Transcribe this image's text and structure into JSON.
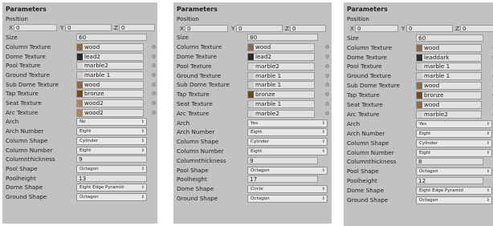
{
  "labels": {
    "title": "Parameters",
    "position": "Position",
    "x": "X",
    "y": "Y",
    "z": "Z",
    "size": "Size",
    "column_texture": "Column Texture",
    "dome_texture": "Dome Texture",
    "pool_texture": "Pool Texture",
    "ground_texture": "Ground Texture",
    "sub_dome_texture": "Sub Dome Texture",
    "tap_texture": "Tap Texture",
    "seat_texture": "Seat Texture",
    "arc_texture": "Arc Texture",
    "arch": "Arch",
    "arch_number": "Arch Number",
    "column_shape": "Column Shape",
    "column_number": "Column Number",
    "columnthickness": "Columnthickness",
    "pool_shape": "Pool Shape",
    "poolheight": "Poolheight",
    "dome_shape": "Dome Shape",
    "ground_shape": "Ground Shape"
  },
  "picker_icon": "object-picker-icon",
  "dropdown_icon": "dropdown-arrows-icon",
  "texture_colors": {
    "wood": "#8a6a4a",
    "lead2": "#2a2a2a",
    "marble2": "#d6d6d6",
    "marble 1": "#cfcfcf",
    "bronze": "#6a4a1e",
    "leaddark": "#2e2e2e"
  },
  "panels": [
    {
      "pos_x": "0",
      "pos_y": "0",
      "pos_z": "0",
      "size": "60",
      "column_texture": "wood",
      "dome_texture": "lead2",
      "pool_texture": "marble2",
      "ground_texture": "marble 1",
      "sub_dome_texture": "wood",
      "tap_texture": "bronze",
      "seat_texture": "wood2",
      "arc_texture": "wood2",
      "arch": "No",
      "arch_number": "Eight",
      "column_shape": "Cylinder",
      "column_number": "Eight",
      "columnthickness": "9",
      "pool_shape": "Octagon",
      "poolheight": "13",
      "dome_shape": "Eight Edge Pyramid",
      "ground_shape": "Octagon"
    },
    {
      "pos_x": "0",
      "pos_y": "0",
      "pos_z": "0",
      "size": "80",
      "column_texture": "wood",
      "dome_texture": "lead2",
      "pool_texture": "marble2",
      "ground_texture": "marble 1",
      "sub_dome_texture": "marble 1",
      "tap_texture": "bronze",
      "seat_texture": "marble 1",
      "arc_texture": "marble2",
      "arch": "Yes",
      "arch_number": "Eight",
      "column_shape": "Cylinder",
      "column_number": "Eight",
      "columnthickness": "9",
      "pool_shape": "Octagon",
      "poolheight": "17",
      "dome_shape": "Circle",
      "ground_shape": "Octagon"
    },
    {
      "pos_x": "0",
      "pos_y": "0",
      "pos_z": "0",
      "size": "60",
      "column_texture": "wood",
      "dome_texture": "leaddark",
      "pool_texture": "marble 1",
      "ground_texture": "marble 1",
      "sub_dome_texture": "wood",
      "tap_texture": "bronze",
      "seat_texture": "wood",
      "arc_texture": "marble2",
      "arch": "Yes",
      "arch_number": "Eight",
      "column_shape": "Cylinder",
      "column_number": "Eight",
      "columnthickness": "8",
      "pool_shape": "Octagon",
      "poolheight": "12",
      "dome_shape": "Eight Edge Pyramid",
      "ground_shape": "Octagon"
    }
  ]
}
